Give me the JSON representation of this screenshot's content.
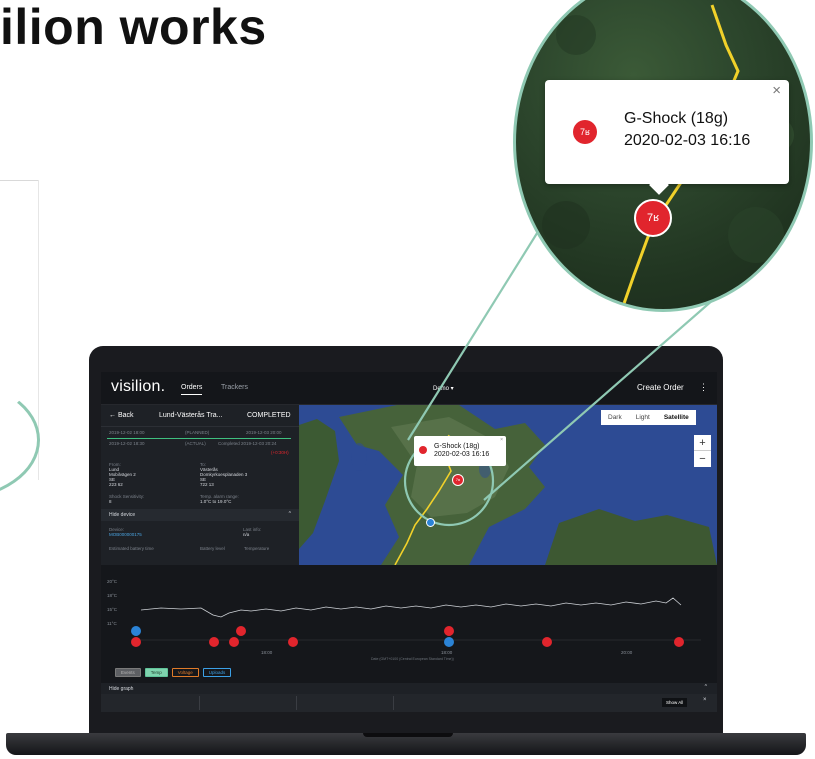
{
  "headline": "ilion works",
  "app": {
    "brand": "visilion.",
    "tabs": [
      "Orders",
      "Trackers"
    ],
    "demo": "Demo ▾",
    "create_order": "Create Order",
    "kebab": "⋮"
  },
  "order": {
    "back": "← Back",
    "route": "Lund-Västerås Tra...",
    "status": "COMPLETED",
    "planned_start": "2019-12-02 18:00",
    "planned_label": "(PLANNED)",
    "planned_end": "2019-12-03 20:00",
    "actual_start": "2019-12-02 18:30",
    "actual_label": "(ACTUAL)",
    "actual_end": "Completed 2019-12-03 20:24",
    "delay": "(+0:30H)",
    "from_label": "From:",
    "from_lines": [
      "Lund",
      "Mobilvägen 2",
      "SE",
      "223 62"
    ],
    "to_label": "To:",
    "to_lines": [
      "Västerås",
      "Domkyrkoesplanaden 3",
      "SE",
      "722 13"
    ],
    "shock_label": "Shock Sensitivity:",
    "shock_value": "8",
    "temp_label": "Temp. alarm range:",
    "temp_value": "1.0°C to 19.0°C",
    "hide_device": "Hide device",
    "device_label": "Device:",
    "device_value": "MOB000000175",
    "last_info_label": "Last info:",
    "last_info_value": "n/a",
    "battery_time": "Estimated battery time",
    "battery_level": "Battery level",
    "temperature": "Temperature"
  },
  "map": {
    "toggles": [
      "Dark",
      "Light",
      "Satellite"
    ],
    "selected_toggle": "Satellite",
    "zoom_in": "+",
    "zoom_out": "−",
    "popup_title": "G-Shock (18g)",
    "popup_time": "2020-02-03 16:16",
    "popup_close": "×",
    "event_icon": "7ʁ"
  },
  "graph": {
    "y_ticks": [
      "20°C",
      "18°C",
      "15°C",
      "11°C"
    ],
    "x_ticks": [
      "18:00",
      "18:00",
      "20:00"
    ],
    "timezone": "Date (GMT+0100 (Central European Standard Time))",
    "legend": [
      "Events",
      "Temp",
      "Voltage",
      "Uploads"
    ],
    "hide_graph": "Hide graph",
    "show_all": "Show All",
    "close": "×",
    "collapse": "^"
  },
  "magnifier": {
    "title": "G-Shock (18g)",
    "time": "2020-02-03 16:16",
    "close": "×",
    "icon": "7ʁ"
  },
  "colors": {
    "accent_red": "#e1252d",
    "accent_blue": "#2b83d6",
    "ring": "#8fc9b3",
    "route": "#f1d12a"
  }
}
